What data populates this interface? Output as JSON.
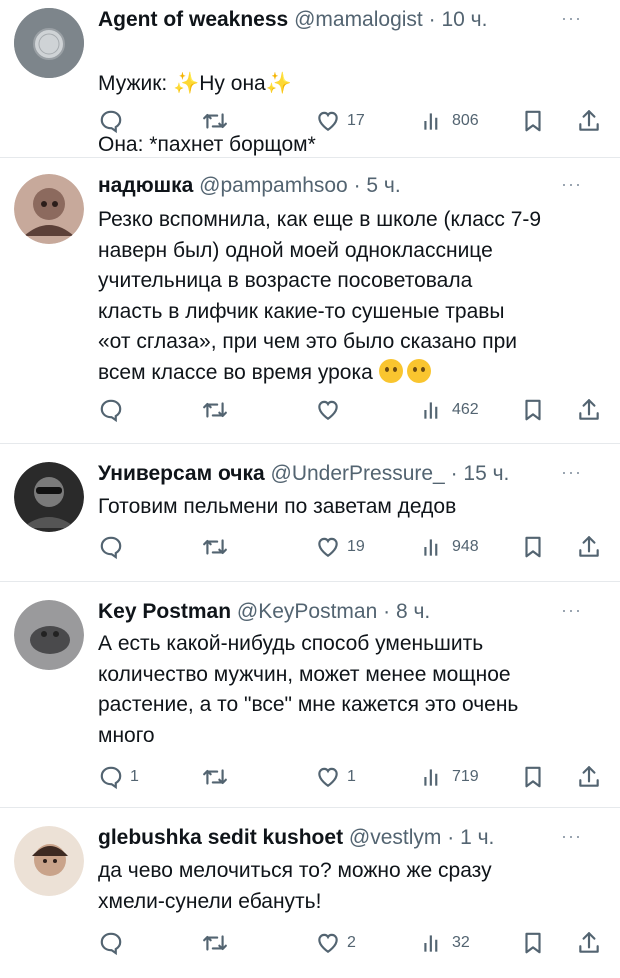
{
  "tweets": [
    {
      "name": "Agent of weakness",
      "handle": "@mamalogist",
      "time": "10 ч.",
      "more": "···",
      "lines": [
        {
          "parts": [
            "Мужик: ",
            "✨",
            "Ну она",
            "✨"
          ]
        },
        {
          "text": "Она: *пахнет борщом*"
        }
      ],
      "replies": "",
      "likes": "17",
      "views": "806",
      "avatar_color": "#8a8f94"
    },
    {
      "name": "надюшка",
      "handle": "@pampamhsoo",
      "time": "5 ч.",
      "more": "···",
      "text": "Резко вспомнила, как еще в школе (класс 7-9\nнаверн был) одной моей однокласснице\nучительница в возрасте посоветовала\nкласть в лифчик какие-то сушеные травы\n«от сглаза», при чем это было сказано при\nвсем классе во время урока",
      "emoji": [
        "crying-face-emoji",
        "pleading-face-emoji"
      ],
      "replies": "",
      "likes": "",
      "views": "462",
      "avatar_color": "#b08a7a"
    },
    {
      "name": "Универсам очка",
      "handle": "@UnderPressure_",
      "time": "15 ч.",
      "more": "···",
      "text": "Готовим пельмени по заветам дедов",
      "replies": "",
      "likes": "19",
      "views": "948",
      "avatar_color": "#3a3a3a"
    },
    {
      "name": "Key Postman",
      "handle": "@KeyPostman",
      "time": "8 ч.",
      "more": "···",
      "text": "А есть какой-нибудь способ уменьшить\nколичество мужчин, может менее мощное\nрастение, а то \"все\" мне кажется это очень\nмного",
      "replies": "1",
      "likes": "1",
      "views": "719",
      "avatar_color": "#7e7e80"
    },
    {
      "name": "glebushka sedit kushoet",
      "handle": "@vestlym",
      "time": "1 ч.",
      "more": "···",
      "text": "да чево мелочиться то? можно же сразу\nхмели-сунели ебануть!",
      "replies": "",
      "likes": "2",
      "views": "32",
      "avatar_color": "#d9c2ad"
    }
  ],
  "separator": " · "
}
